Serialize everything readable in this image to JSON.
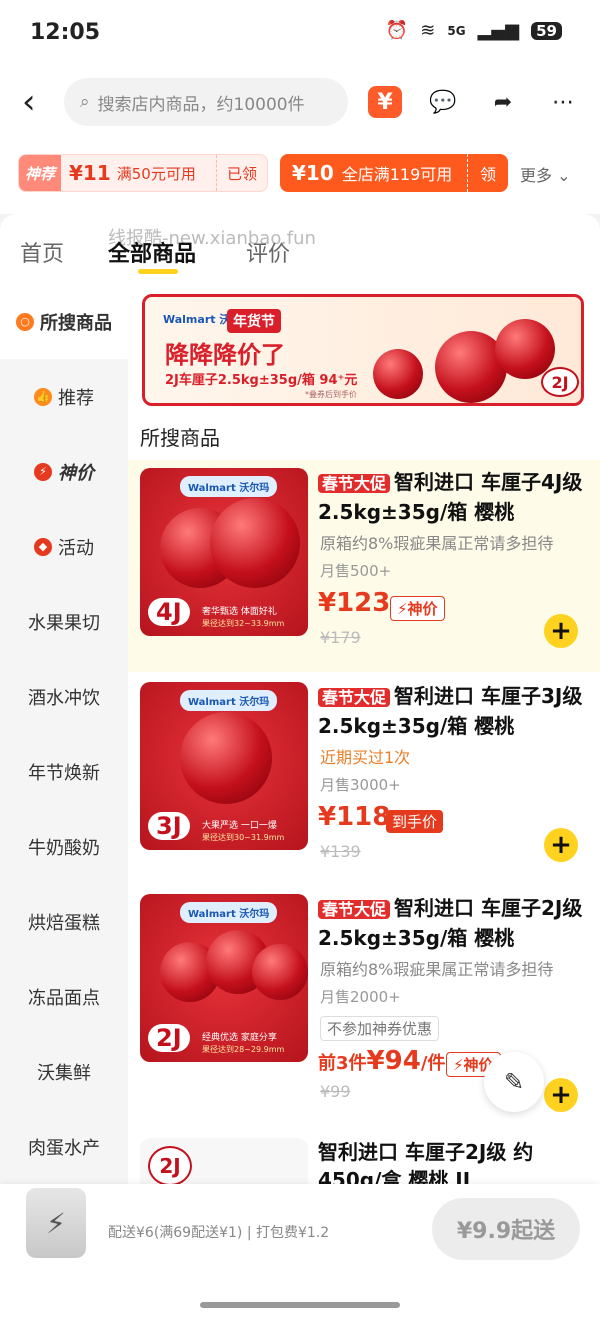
{
  "status": {
    "time": "12:05",
    "network": "5G",
    "battery": "59"
  },
  "topbar": {
    "search_placeholder": "搜索店内商品，约10000件",
    "wallet_icon": "¥"
  },
  "coupons": {
    "c1_tag": "神荐",
    "c1_amount": "¥11",
    "c1_condition": "满50元可用",
    "c1_status": "已领",
    "c2_amount": "¥10",
    "c2_condition": "全店满119可用",
    "c2_action": "领",
    "more": "更多"
  },
  "tabs": {
    "home": "首页",
    "all": "全部商品",
    "reviews": "评价",
    "watermark": "线报酷-new.xianbao.fun"
  },
  "sidebar": {
    "items": [
      {
        "label": "所搜商品"
      },
      {
        "label": "推荐"
      },
      {
        "label": "神价"
      },
      {
        "label": "活动"
      },
      {
        "label": "水果果切"
      },
      {
        "label": "酒水冲饮"
      },
      {
        "label": "年节焕新"
      },
      {
        "label": "牛奶酸奶"
      },
      {
        "label": "烘焙蛋糕"
      },
      {
        "label": "冻品面点"
      },
      {
        "label": "沃集鲜"
      },
      {
        "label": "肉蛋水产"
      }
    ]
  },
  "banner": {
    "brand": "Walmart 沃尔玛",
    "festival": "年货节",
    "headline": "降降降价了",
    "spec": "2J车厘子2.5kg±35g/箱 94⁺元",
    "note": "*叠券后到手价",
    "grade": "2J"
  },
  "section_title": "所搜商品",
  "products": [
    {
      "promo": "春节大促",
      "title": "智利进口 车厘子4J级 2.5kg±35g/箱 樱桃",
      "desc": "原箱约8%瑕疵果属正常请多担待",
      "sales": "月售500+",
      "price": "¥123",
      "tag": "神价",
      "orig": "¥179",
      "grade": "4J",
      "brand": "Walmart 沃尔玛",
      "slogan": "奢华甄选 体面好礼",
      "size": "果径达到32~33.9mm"
    },
    {
      "promo": "春节大促",
      "title": "智利进口 车厘子3J级 2.5kg±35g/箱 樱桃",
      "desc": "近期买过1次",
      "sales": "月售3000+",
      "price": "¥118",
      "tag": "到手价",
      "orig": "¥139",
      "grade": "3J",
      "brand": "Walmart 沃尔玛",
      "slogan": "大果严选 一口一爆",
      "size": "果径达到30~31.9mm"
    },
    {
      "promo": "春节大促",
      "title": "智利进口 车厘子2J级 2.5kg±35g/箱 樱桃",
      "desc": "原箱约8%瑕疵果属正常请多担待",
      "sales": "月售2000+",
      "nocoupon": "不参加神券优惠",
      "price_prefix": "前3件",
      "price": "¥94",
      "price_unit": "/件",
      "tag": "神价",
      "orig": "¥99",
      "grade": "2J",
      "brand": "Walmart 沃尔玛",
      "slogan": "经典优选 家庭分享",
      "size": "果径达到28~29.9mm"
    },
    {
      "title": "智利进口 车厘子2J级 约450g/盒 樱桃 JJ",
      "grade": "2J"
    }
  ],
  "bottombar": {
    "delivery": "配送¥6(满69配送¥1) | 打包费¥1.2",
    "start": "¥9.9起送"
  },
  "colors": {
    "accent": "#ff5a1e",
    "price_red": "#e63a1e",
    "add_yellow": "#ffd21f"
  }
}
